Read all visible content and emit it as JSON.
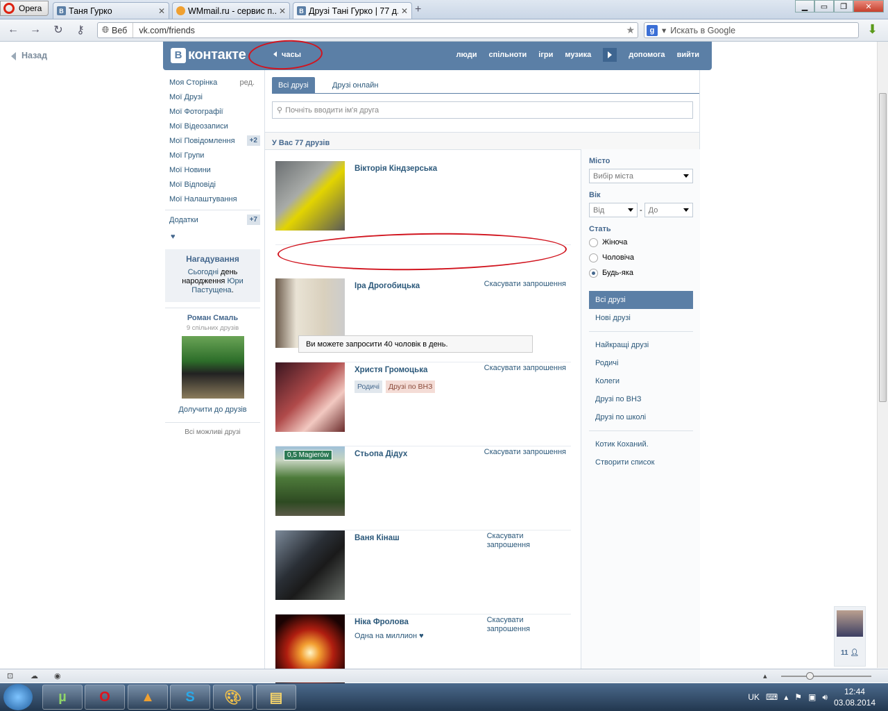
{
  "browser": {
    "opera_label": "Opera",
    "tabs": [
      {
        "title": "Таня Гурко",
        "icon": "В"
      },
      {
        "title": "WMmail.ru - сервис п...",
        "icon": ""
      },
      {
        "title": "Друзі Тані Гурко | 77 д...",
        "icon": "В"
      }
    ],
    "address_prefix": "Веб",
    "url": "vk.com/friends",
    "search_placeholder": "Искать в Google"
  },
  "page": {
    "back_label": "Назад",
    "logo_text": "контакте",
    "clock_label": "часы",
    "nav": [
      "люди",
      "спільноти",
      "ігри",
      "музика",
      "допомога",
      "вийти"
    ]
  },
  "sidebar": {
    "items": [
      {
        "label": "Моя Сторінка",
        "extra": "ред."
      },
      {
        "label": "Мої Друзі",
        "extra": ""
      },
      {
        "label": "Мої Фотографії",
        "extra": ""
      },
      {
        "label": "Мої Відеозаписи",
        "extra": ""
      },
      {
        "label": "Мої Повідомлення",
        "extra": "+2"
      },
      {
        "label": "Мої Групи",
        "extra": ""
      },
      {
        "label": "Мої Новини",
        "extra": ""
      },
      {
        "label": "Мої Відповіді",
        "extra": ""
      },
      {
        "label": "Мої Налаштування",
        "extra": ""
      }
    ],
    "apps": {
      "label": "Додатки",
      "extra": "+7"
    },
    "heart": "♥",
    "reminder": {
      "title": "Нагадування",
      "t1": "Сьогодні",
      "t2": " день народження ",
      "link": "Юри Пастущена",
      "t3": "."
    },
    "suggest": {
      "name": "Роман Смаль",
      "mutual": "9 спільних друзів",
      "add": "Долучити до друзів",
      "all": "Всі можливі друзі"
    }
  },
  "main": {
    "tab_all": "Всі друзі",
    "tab_online": "Друзі онлайн",
    "search_placeholder": "Почніть вводити ім'я друга",
    "count": "У Вас 77 друзів",
    "notice": "Ви можете запросити 40 чоловік в день.",
    "friends": [
      {
        "name": "Вікторія Кіндзерська",
        "action": "",
        "tags": [],
        "status": ""
      },
      {
        "name": "Іра Дрогобицька",
        "action": "Скасувати запрошення",
        "tags": [],
        "status": ""
      },
      {
        "name": "Христя Громоцька",
        "action": "Скасувати запрошення",
        "tags": [
          "Родичі",
          "Друзі по ВНЗ"
        ],
        "status": ""
      },
      {
        "name": "Стьопа Дідух",
        "action": "Скасувати запрошення",
        "tags": [],
        "status": ""
      },
      {
        "name": "Ваня Кінаш",
        "action": "Скасувати\nзапрошення",
        "tags": [],
        "status": ""
      },
      {
        "name": "Ніка Фролова",
        "action": "Скасувати\nзапрошення",
        "tags": [],
        "status": "Одна на миллион ♥"
      }
    ],
    "photo_sign": "0,5 Magierów"
  },
  "filters": {
    "city_label": "Місто",
    "city_select": "Вибір міста",
    "age_label": "Вік",
    "age_from": "Від",
    "age_dash": "-",
    "age_to": "До",
    "sex_label": "Стать",
    "sex_options": [
      "Жіноча",
      "Чоловіча",
      "Будь-яка"
    ],
    "menu1": [
      "Всі друзі",
      "Нові друзі"
    ],
    "menu2": [
      "Найкращі друзі",
      "Родичі",
      "Колеги",
      "Друзі по ВНЗ",
      "Друзі по школі"
    ],
    "menu3": [
      "Котик Коханий.",
      "Створити список"
    ]
  },
  "chat": {
    "count": "11"
  },
  "taskbar": {
    "lang": "UK",
    "time": "12:44",
    "date": "03.08.2014"
  }
}
